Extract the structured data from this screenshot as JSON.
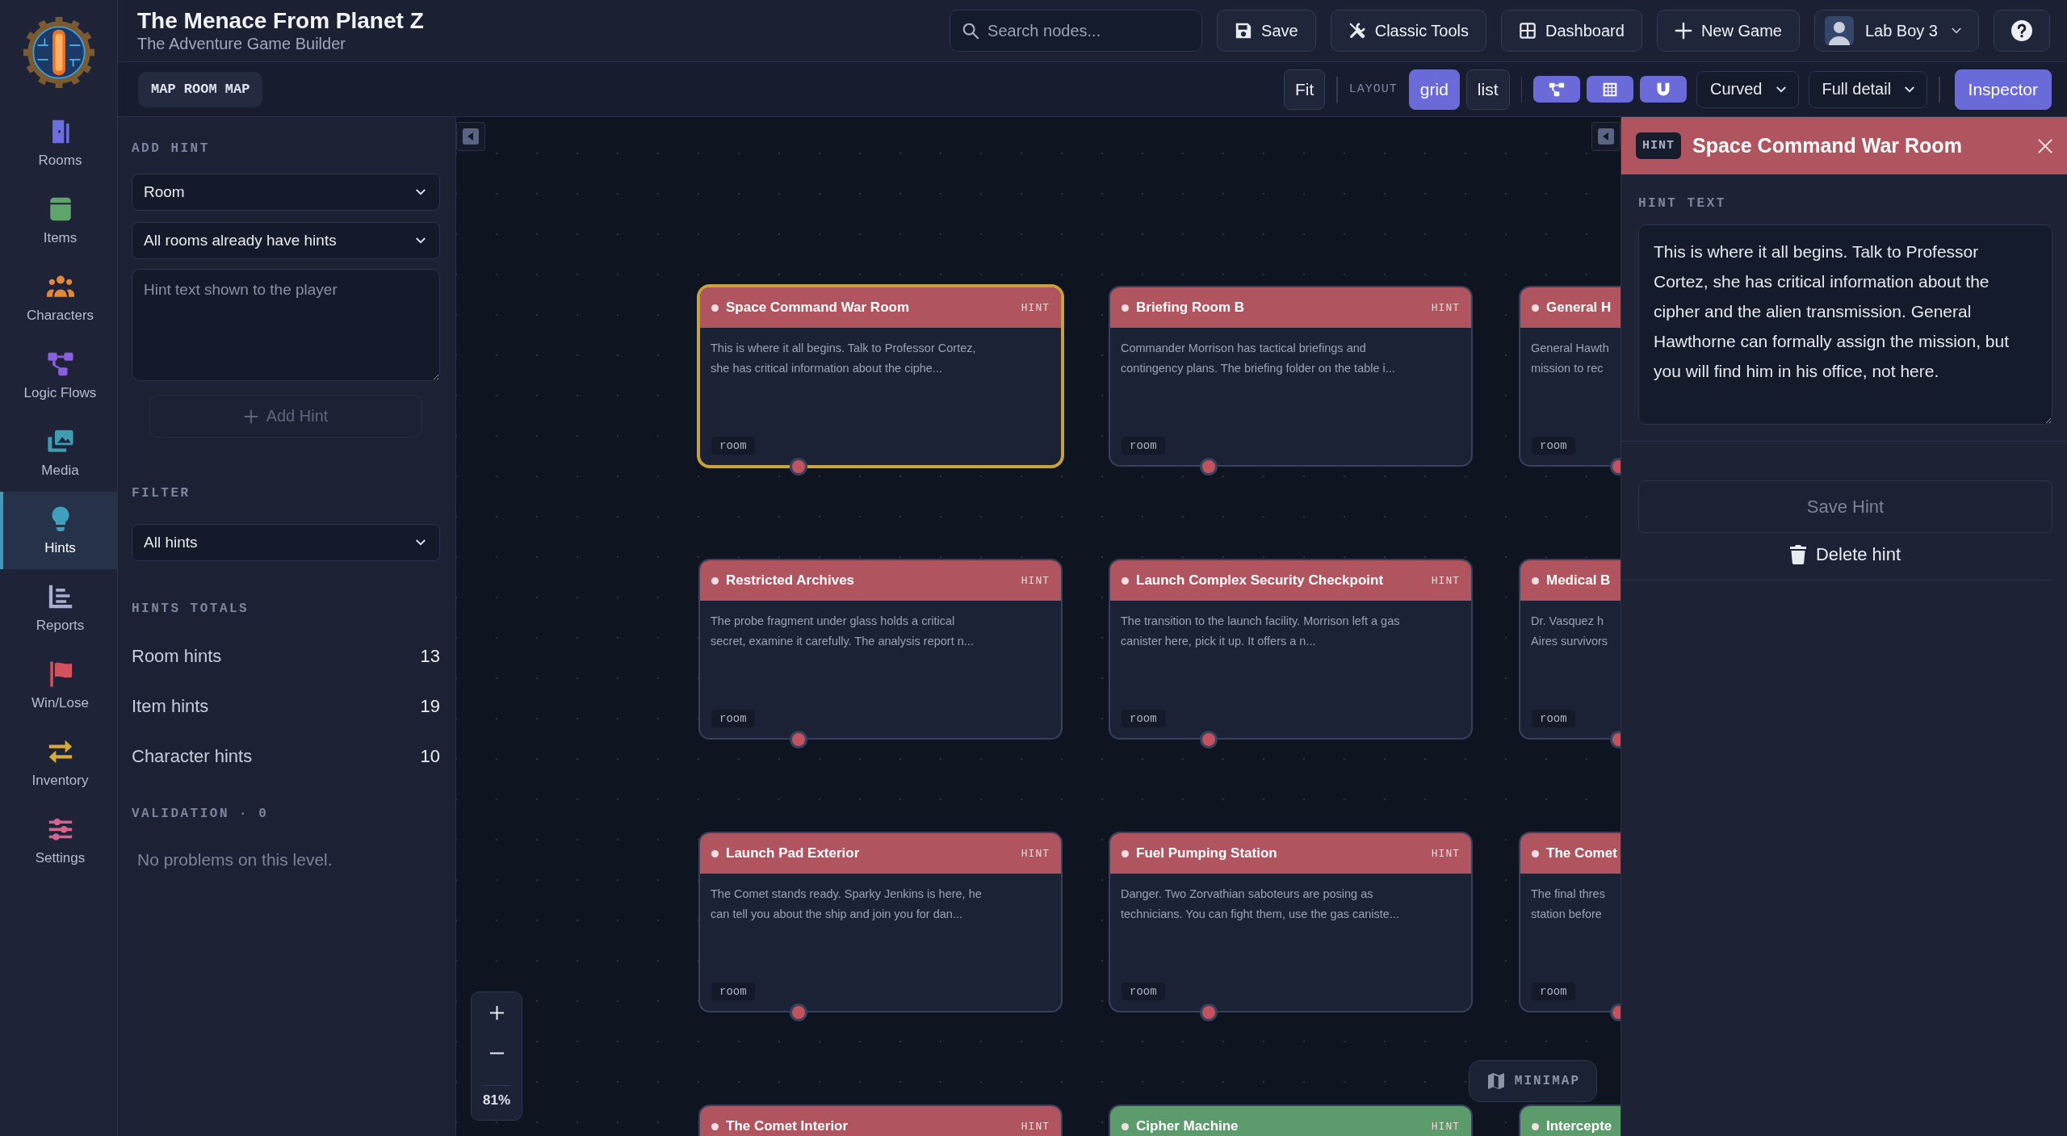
{
  "app": {
    "title": "The Menace From Planet Z",
    "subtitle": "The Adventure Game Builder"
  },
  "nav": [
    {
      "label": "Rooms",
      "selected": false
    },
    {
      "label": "Items",
      "selected": false
    },
    {
      "label": "Characters",
      "selected": false
    },
    {
      "label": "Logic Flows",
      "selected": false
    },
    {
      "label": "Media",
      "selected": false
    },
    {
      "label": "Hints",
      "selected": true
    },
    {
      "label": "Reports",
      "selected": false
    },
    {
      "label": "Win/Lose",
      "selected": false
    },
    {
      "label": "Inventory",
      "selected": false
    },
    {
      "label": "Settings",
      "selected": false
    }
  ],
  "header": {
    "search": {
      "placeholder": "Search nodes..."
    },
    "buttons": [
      {
        "label": "Save"
      },
      {
        "label": "Classic Tools"
      },
      {
        "label": "Dashboard"
      },
      {
        "label": "New Game"
      }
    ],
    "user": {
      "name": "Lab Boy 3"
    }
  },
  "toolbar": {
    "map_label": "MAP ROOM MAP",
    "fit": "Fit",
    "layout_label": "LAYOUT",
    "layouts": [
      {
        "label": "grid",
        "selected": true
      },
      {
        "label": "list",
        "selected": false
      }
    ],
    "view_toggles": [
      {
        "on": true
      },
      {
        "on": true
      },
      {
        "on": true
      }
    ],
    "edge_style": "Curved",
    "detail": "Full detail",
    "inspector": {
      "label": "Inspector",
      "on": true
    }
  },
  "add_hint": {
    "heading": "ADD HINT",
    "type": "Room",
    "target": "All rooms already have hints",
    "placeholder": "Hint text shown to the player",
    "button": {
      "label": "Add Hint",
      "disabled": true
    }
  },
  "filter": {
    "heading": "FILTER",
    "value": "All hints"
  },
  "totals": {
    "heading": "HINTS TOTALS",
    "rows": [
      {
        "label": "Room hints",
        "count": "13"
      },
      {
        "label": "Item hints",
        "count": "19"
      },
      {
        "label": "Character hints",
        "count": "10"
      }
    ]
  },
  "validation": {
    "heading": "VALIDATION · 0",
    "message": "No problems on this level."
  },
  "canvas": {
    "nodes": [
      {
        "title": "Space Command War Room",
        "badge": "HINT",
        "lines": [
          "This is where it all begins. Talk to Professor Cortez,",
          "she has critical information about the ciphe..."
        ],
        "tag": "room",
        "color": "#b0555f",
        "selected": true
      },
      {
        "title": "Briefing Room B",
        "badge": "HINT",
        "lines": [
          "Commander Morrison has tactical briefings and",
          "contingency plans. The briefing folder on the table i..."
        ],
        "tag": "room",
        "color": "#b0555f",
        "selected": false
      },
      {
        "title": "General H",
        "lines": [
          "General Hawth",
          "mission to rec"
        ],
        "tag": "room",
        "color": "#b0555f",
        "selected": false
      },
      {
        "title": "Restricted Archives",
        "badge": "HINT",
        "lines": [
          "The probe fragment under glass holds a critical",
          "secret, examine it carefully. The analysis report n..."
        ],
        "tag": "room",
        "color": "#b0555f",
        "selected": false
      },
      {
        "title": "Launch Complex Security Checkpoint",
        "badge": "HINT",
        "lines": [
          "The transition to the launch facility. Morrison left a gas",
          "canister here, pick it up. It offers a n..."
        ],
        "tag": "room",
        "color": "#b0555f",
        "selected": false
      },
      {
        "title": "Medical B",
        "lines": [
          "Dr. Vasquez h",
          "Aires survivors"
        ],
        "tag": "room",
        "color": "#b0555f",
        "selected": false
      },
      {
        "title": "Launch Pad Exterior",
        "badge": "HINT",
        "lines": [
          "The Comet stands ready. Sparky Jenkins is here, he",
          "can tell you about the ship and join you for dan..."
        ],
        "tag": "room",
        "color": "#b0555f",
        "selected": false
      },
      {
        "title": "Fuel Pumping Station",
        "badge": "HINT",
        "lines": [
          "Danger. Two Zorvathian saboteurs are posing as",
          "technicians. You can fight them, use the gas caniste..."
        ],
        "tag": "room",
        "color": "#b0555f",
        "selected": false
      },
      {
        "title": "The Comet",
        "lines": [
          "The final thres",
          "station before"
        ],
        "tag": "room",
        "color": "#b0555f",
        "selected": false
      },
      {
        "title": "The Comet Interior",
        "badge": "HINT",
        "color": "#b0555f",
        "selected": false
      },
      {
        "title": "Cipher Machine",
        "badge": "HINT",
        "color": "#5c9b6b",
        "selected": false
      },
      {
        "title": "Intercepte",
        "color": "#5c9b6b",
        "selected": false
      }
    ],
    "zoom": "81%",
    "minimap": "MINIMAP"
  },
  "inspector": {
    "badge": "HINT",
    "title": "Space Command War Room",
    "field_label": "HINT TEXT",
    "text": "This is where it all begins. Talk to Professor Cortez, she has critical information about the cipher and the alien transmission. General Hawthorne can formally assign the mission, but you will find him in his office, not here.",
    "save_button": {
      "label": "Save Hint",
      "disabled": true
    },
    "delete_button": {
      "label": "Delete hint"
    }
  }
}
